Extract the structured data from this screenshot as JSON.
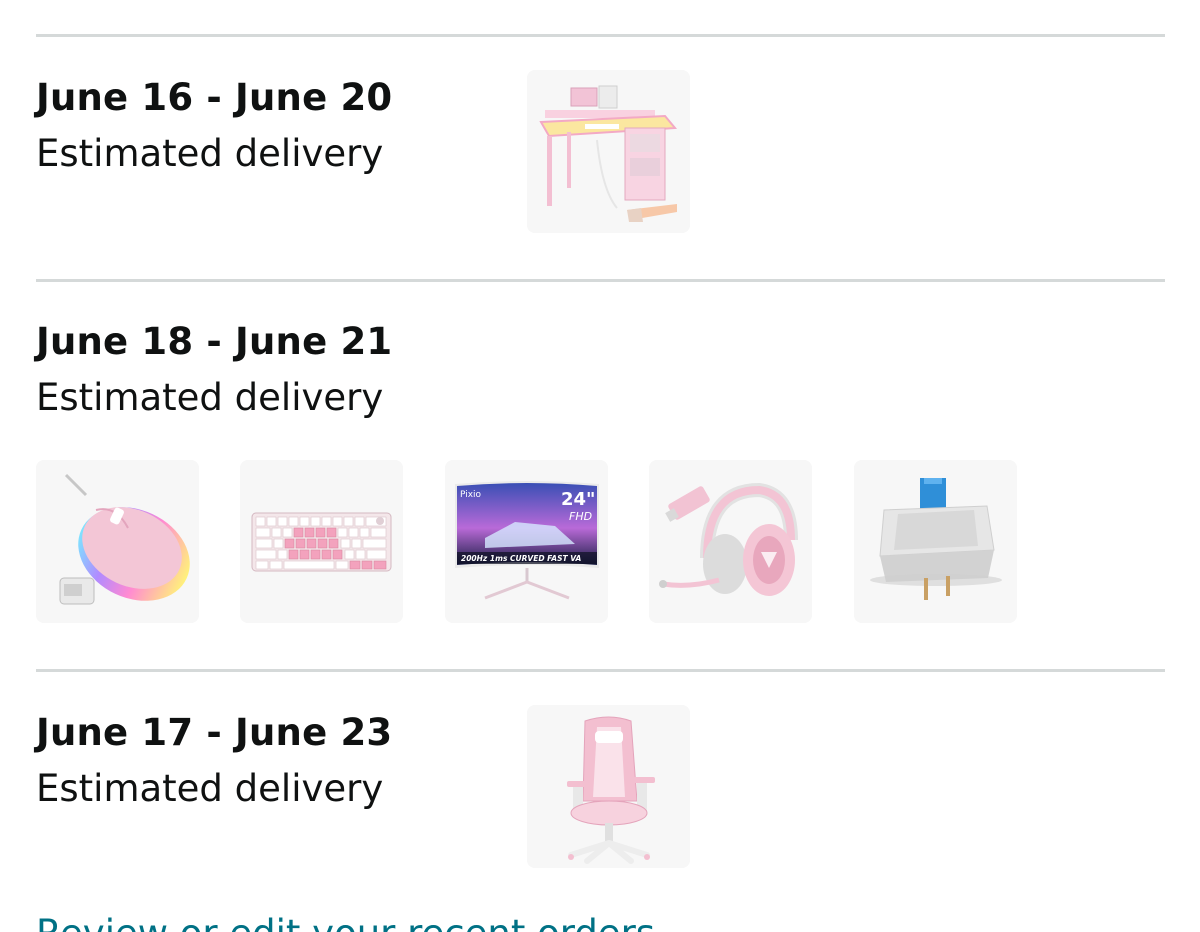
{
  "groups": [
    {
      "dates": "June 16 - June 20",
      "label": "Estimated delivery",
      "items": [
        {
          "icon": "pink-gaming-desk-image"
        }
      ]
    },
    {
      "dates": "June 18 - June 21",
      "label": "Estimated delivery",
      "items": [
        {
          "icon": "pink-wireless-mouse-image"
        },
        {
          "icon": "pink-mechanical-keyboard-image"
        },
        {
          "icon": "curved-monitor-image",
          "brand": "Pixio",
          "size": "24\"",
          "res": "FHD",
          "caption": "200Hz 1ms CURVED FAST VA"
        },
        {
          "icon": "pink-headset-image"
        },
        {
          "icon": "keyboard-switch-image"
        }
      ]
    },
    {
      "dates": "June 17 - June 23",
      "label": "Estimated delivery",
      "items": [
        {
          "icon": "pink-gaming-chair-image"
        }
      ]
    }
  ],
  "footer_link": "Review or edit your recent orders",
  "colors": {
    "divider": "#d5d9d9",
    "tile_bg": "#f7f7f7",
    "link": "#007185",
    "text": "#0f1111",
    "pink": "#f6c6d4"
  }
}
